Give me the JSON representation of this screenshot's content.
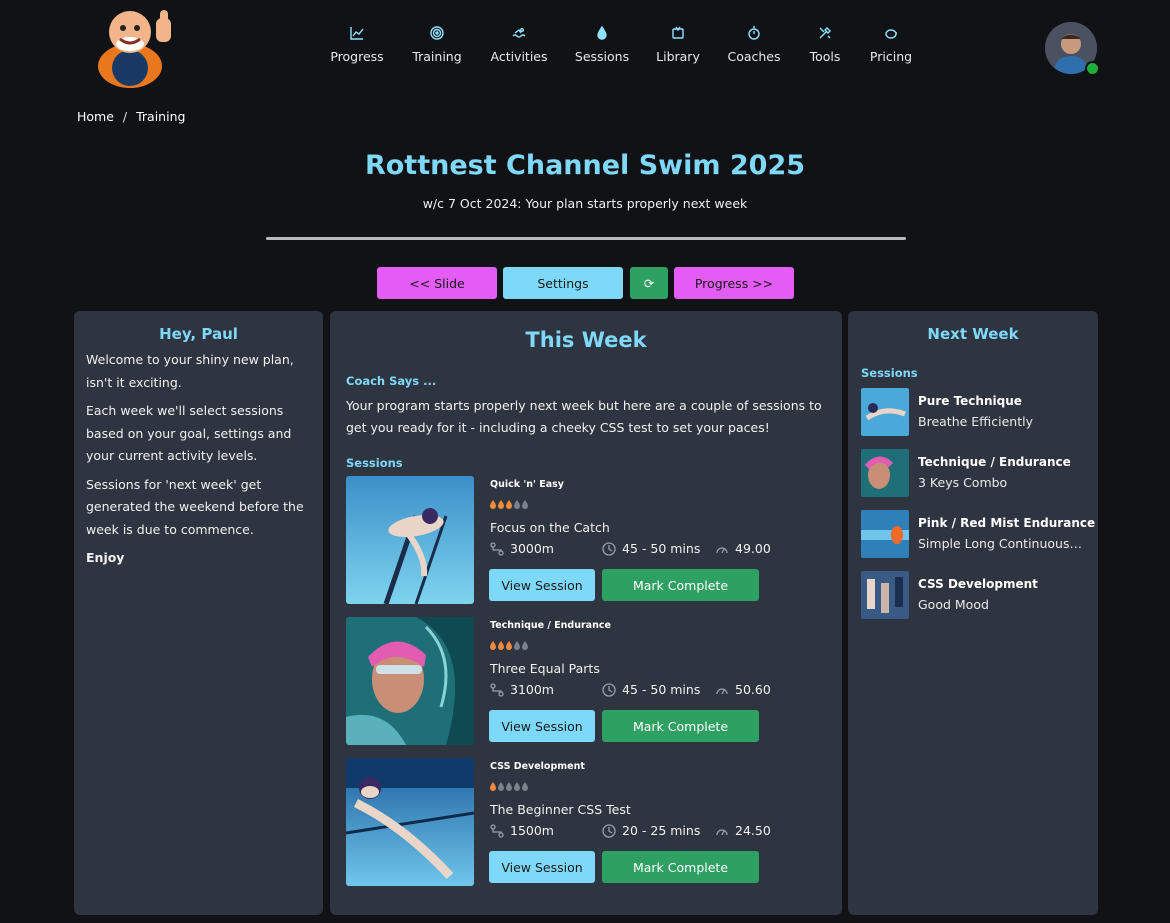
{
  "nav": {
    "items": [
      {
        "label": "Progress",
        "icon": "chart-line-icon"
      },
      {
        "label": "Training",
        "icon": "target-icon"
      },
      {
        "label": "Activities",
        "icon": "swimmer-icon"
      },
      {
        "label": "Sessions",
        "icon": "drop-icon"
      },
      {
        "label": "Library",
        "icon": "book-icon"
      },
      {
        "label": "Coaches",
        "icon": "stopwatch-icon"
      },
      {
        "label": "Tools",
        "icon": "tools-icon"
      },
      {
        "label": "Pricing",
        "icon": "piggy-bank-icon"
      }
    ]
  },
  "breadcrumb": {
    "home": "Home",
    "separator": "/",
    "current": "Training"
  },
  "header": {
    "title": "Rottnest Channel Swim 2025",
    "subtitle": "w/c 7 Oct 2024: Your plan starts properly next week"
  },
  "controls": {
    "slide": "<< Slide",
    "settings": "Settings",
    "refresh": "⟳",
    "progress": "Progress >>"
  },
  "left_panel": {
    "greeting": "Hey, Paul",
    "p1": "Welcome to your shiny new plan, isn't it exciting.",
    "p2": "Each week we'll select sessions based on your goal, settings and your current activity levels.",
    "p3": "Sessions for 'next week' get generated the weekend before the week is due to commence.",
    "p4": "Enjoy"
  },
  "this_week": {
    "heading": "This Week",
    "coach_label": "Coach Says ...",
    "coach_text": "Your program starts properly next week but here are a couple of sessions to get you ready for it - including a cheeky CSS test to set your paces!",
    "sessions_label": "Sessions",
    "sessions": [
      {
        "type": "Quick 'n' Easy",
        "intensity": 3,
        "name": "Focus on the Catch",
        "distance": "3000m",
        "duration": "45 - 50 mins",
        "score": "49.00",
        "view": "View Session",
        "complete": "Mark Complete"
      },
      {
        "type": "Technique / Endurance",
        "intensity": 3,
        "name": "Three Equal Parts",
        "distance": "3100m",
        "duration": "45 - 50 mins",
        "score": "50.60",
        "view": "View Session",
        "complete": "Mark Complete"
      },
      {
        "type": "CSS Development",
        "intensity": 1,
        "name": "The Beginner CSS Test",
        "distance": "1500m",
        "duration": "20 - 25 mins",
        "score": "24.50",
        "view": "View Session",
        "complete": "Mark Complete"
      }
    ]
  },
  "next_week": {
    "heading": "Next Week",
    "sessions_label": "Sessions",
    "items": [
      {
        "type": "Pure Technique",
        "name": "Breathe Efficiently"
      },
      {
        "type": "Technique / Endurance",
        "name": "3 Keys Combo"
      },
      {
        "type": "Pink / Red Mist Endurance",
        "name": "Simple Long Continuous…"
      },
      {
        "type": "CSS Development",
        "name": "Good Mood"
      }
    ]
  },
  "colors": {
    "accent": "#7fd8f8",
    "magenta": "#e25cf5",
    "green": "#2ea061",
    "panel": "#2e3440",
    "flame": "#f08a3c"
  }
}
